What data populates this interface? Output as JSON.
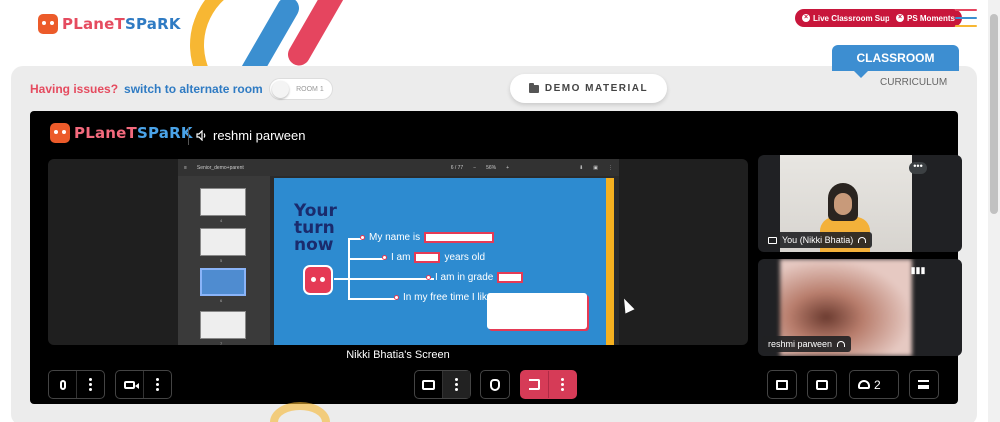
{
  "brand": {
    "logo_a": "PLaneT",
    "logo_b": "SPaRK",
    "accent_red": "#e5455f",
    "accent_blue": "#2f7bc3"
  },
  "header": {
    "live_support": "Live Classroom Support",
    "ps_moments": "PS Moments"
  },
  "tabs": {
    "classroom": "CLASSROOM",
    "curriculum": "CURRICULUM"
  },
  "issues": {
    "having": "Having issues?",
    "switch": "switch to alternate room",
    "toggle_label": "ROOM 1"
  },
  "demo_material": "DEMO MATERIAL",
  "meeting": {
    "speaker": "reshmi parween",
    "screen_caption": "Nikki Bhatia's Screen",
    "participants": [
      {
        "name": "You (Nikki Bhatia)"
      },
      {
        "name": "reshmi parween"
      }
    ],
    "people_count": "2"
  },
  "shared_screen": {
    "file_name": "Senior_demo+parent",
    "page_indicator": "6 / 77",
    "zoom": "56%",
    "thumb_nums": [
      "4",
      "5",
      "6",
      "7"
    ],
    "slide_title": "Your turn now",
    "prompts": {
      "name": "My name is",
      "age_prefix": "I am",
      "age_suffix": "years old",
      "grade": "I am in grade",
      "free_time": "In my free time I like"
    }
  }
}
